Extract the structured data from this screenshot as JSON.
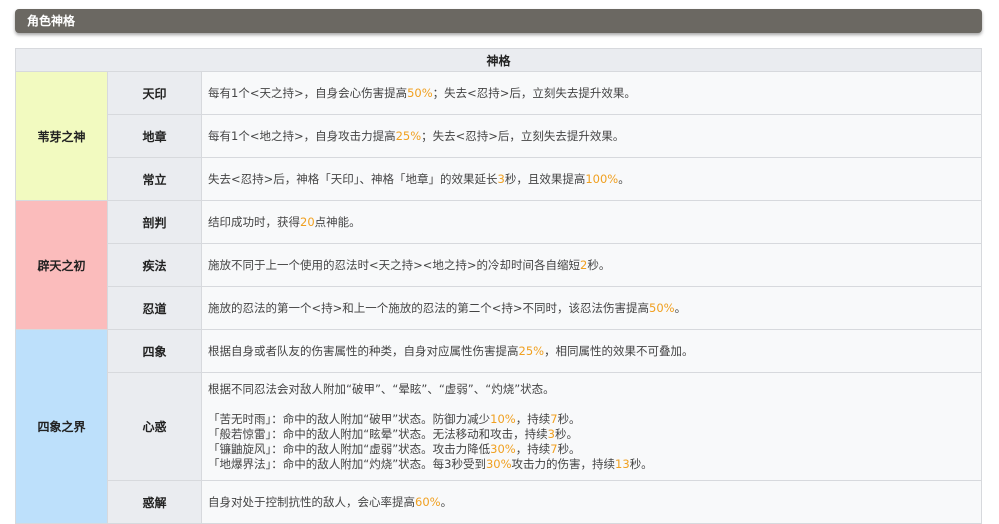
{
  "header": {
    "title": "角色神格"
  },
  "table": {
    "heading": "神格",
    "colors": {
      "group1": "#f2fac0",
      "group2": "#fbbcbc",
      "group3": "#bde0fb",
      "highlight": "#f0a020"
    },
    "groups": [
      {
        "name": "苇芽之神",
        "rows": [
          {
            "name": "天印",
            "lines": [
              [
                {
                  "t": "每有1个<天之持>，自身会心伤害提高"
                },
                {
                  "t": "50%",
                  "h": true
                },
                {
                  "t": "；失去<忍持>后，立刻失去提升效果。"
                }
              ]
            ]
          },
          {
            "name": "地章",
            "lines": [
              [
                {
                  "t": "每有1个<地之持>，自身攻击力提高"
                },
                {
                  "t": "25%",
                  "h": true
                },
                {
                  "t": "；失去<忍持>后，立刻失去提升效果。"
                }
              ]
            ]
          },
          {
            "name": "常立",
            "lines": [
              [
                {
                  "t": "失去<忍持>后，神格「天印」、神格「地章」的效果延长"
                },
                {
                  "t": "3",
                  "h": true
                },
                {
                  "t": "秒，且效果提高"
                },
                {
                  "t": "100%",
                  "h": true
                },
                {
                  "t": "。"
                }
              ]
            ]
          }
        ]
      },
      {
        "name": "辟天之初",
        "rows": [
          {
            "name": "剖判",
            "lines": [
              [
                {
                  "t": "结印成功时，获得"
                },
                {
                  "t": "20",
                  "h": true
                },
                {
                  "t": "点神能。"
                }
              ]
            ]
          },
          {
            "name": "疾法",
            "lines": [
              [
                {
                  "t": "施放不同于上一个使用的忍法时<天之持><地之持>的冷却时间各自缩短"
                },
                {
                  "t": "2",
                  "h": true
                },
                {
                  "t": "秒。"
                }
              ]
            ]
          },
          {
            "name": "忍道",
            "lines": [
              [
                {
                  "t": "施放的忍法的第一个<持>和上一个施放的忍法的第二个<持>不同时，该忍法伤害提高"
                },
                {
                  "t": "50%",
                  "h": true
                },
                {
                  "t": "。"
                }
              ]
            ]
          }
        ]
      },
      {
        "name": "四象之界",
        "rows": [
          {
            "name": "四象",
            "lines": [
              [
                {
                  "t": "根据自身或者队友的伤害属性的种类，自身对应属性伤害提高"
                },
                {
                  "t": "25%",
                  "h": true
                },
                {
                  "t": "，相同属性的效果不可叠加。"
                }
              ]
            ]
          },
          {
            "name": "心惑",
            "lines": [
              [
                {
                  "t": "根据不同忍法会对敌人附加“破甲”、“晕眩”、“虚弱”、“灼烧”状态。"
                }
              ],
              [],
              [
                {
                  "t": "「苦无时雨」：命中的敌人附加“破甲”状态。防御力减少"
                },
                {
                  "t": "10%",
                  "h": true
                },
                {
                  "t": "，持续"
                },
                {
                  "t": "7",
                  "h": true
                },
                {
                  "t": "秒。"
                }
              ],
              [
                {
                  "t": "「般若惊雷」：命中的敌人附加“眩晕”状态。无法移动和攻击，持续"
                },
                {
                  "t": "3",
                  "h": true
                },
                {
                  "t": "秒。"
                }
              ],
              [
                {
                  "t": "「镰鼬旋风」：命中的敌人附加“虚弱”状态。攻击力降低"
                },
                {
                  "t": "30%",
                  "h": true
                },
                {
                  "t": "，持续"
                },
                {
                  "t": "7",
                  "h": true
                },
                {
                  "t": "秒。"
                }
              ],
              [
                {
                  "t": "「地爆界法」：命中的敌人附加“灼烧”状态。每3秒受到"
                },
                {
                  "t": "30%",
                  "h": true
                },
                {
                  "t": "攻击力的伤害，持续"
                },
                {
                  "t": "13",
                  "h": true
                },
                {
                  "t": "秒。"
                }
              ]
            ]
          },
          {
            "name": "惑解",
            "lines": [
              [
                {
                  "t": "自身对处于控制抗性的敌人，会心率提高"
                },
                {
                  "t": "60%",
                  "h": true
                },
                {
                  "t": "。"
                }
              ]
            ]
          }
        ]
      }
    ]
  }
}
